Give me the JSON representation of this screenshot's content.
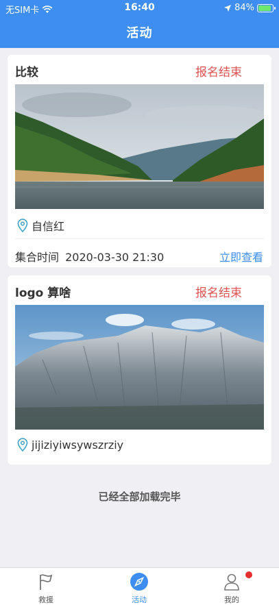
{
  "status_bar": {
    "carrier": "无SIM卡",
    "time": "16:40",
    "battery": "84%",
    "battery_level": 0.84
  },
  "header": {
    "title": "活动"
  },
  "activities": [
    {
      "title": "比较",
      "status": "报名结束",
      "image_icon": "lake-landscape-photo",
      "location": "自信红",
      "meeting_label": "集合时间",
      "meeting_time": "2020-03-30 21:30",
      "view_label": "立即查看"
    },
    {
      "title": "logo 算啥",
      "status": "报名结束",
      "image_icon": "mountain-landscape-photo",
      "location": "jijiziyiwsywszrziy"
    }
  ],
  "footer": {
    "loaded_all": "已经全部加载完毕"
  },
  "tabbar": {
    "items": [
      {
        "label": "救援",
        "icon": "flag-icon",
        "active": false
      },
      {
        "label": "活动",
        "icon": "compass-icon",
        "active": true
      },
      {
        "label": "我的",
        "icon": "person-icon",
        "active": false,
        "badge": true
      }
    ]
  },
  "colors": {
    "primary": "#3d8ef0",
    "status_red": "#e05252",
    "background": "#efeff4"
  }
}
